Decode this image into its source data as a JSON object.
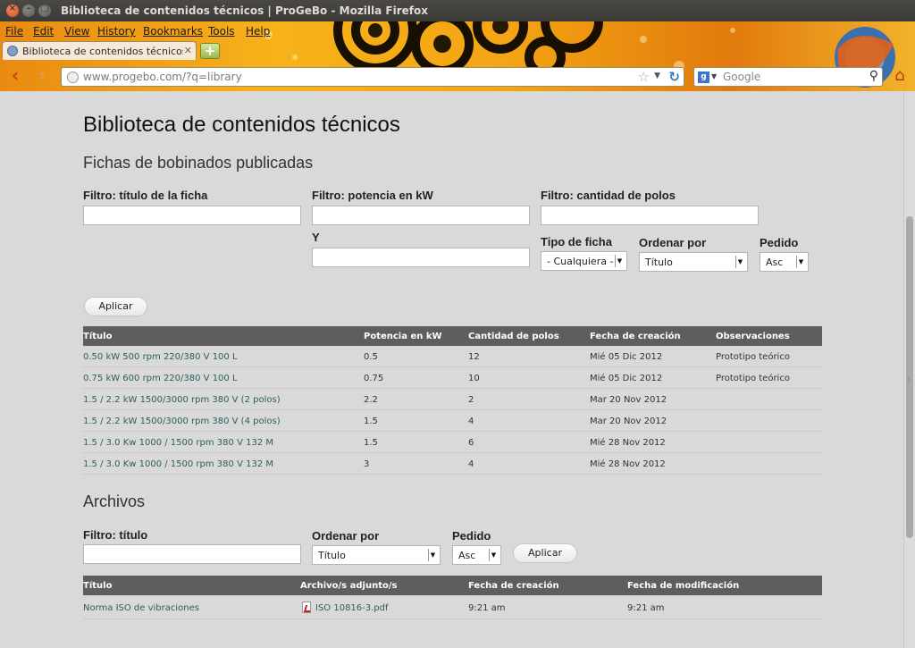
{
  "window": {
    "title": "Biblioteca de contenidos técnicos | ProGeBo - Mozilla Firefox"
  },
  "menu": {
    "file": "File",
    "edit": "Edit",
    "view": "View",
    "history": "History",
    "bookmarks": "Bookmarks",
    "tools": "Tools",
    "help": "Help"
  },
  "tab": {
    "label": "Biblioteca de contenidos técnicos | ..."
  },
  "navbar": {
    "url": "www.progebo.com/?q=library",
    "search_placeholder": "Google"
  },
  "page": {
    "title": "Biblioteca de contenidos técnicos",
    "fichas": {
      "heading": "Fichas de bobinados publicadas",
      "filter_title_label": "Filtro: título de la ficha",
      "filter_title_value": "",
      "filter_power_label": "Filtro: potencia en kW",
      "filter_power_value": "",
      "filter_y_label": "Y",
      "filter_y_value": "",
      "filter_poles_label": "Filtro: cantidad de polos",
      "filter_poles_value": "",
      "type_label": "Tipo de ficha",
      "type_value": "- Cualquiera -",
      "order_label": "Ordenar por",
      "order_value": "Título",
      "sort_label": "Pedido",
      "sort_value": "Asc",
      "apply_label": "Aplicar",
      "columns": [
        "Título",
        "Potencia en kW",
        "Cantidad de polos",
        "Fecha de creación",
        "Observaciones"
      ],
      "rows": [
        {
          "title": "0.50 kW 500 rpm 220/380 V 100 L",
          "power": "0.5",
          "poles": "12",
          "date": "Mié 05 Dic 2012",
          "notes": "Prototipo teórico"
        },
        {
          "title": "0.75 kW 600 rpm 220/380 V 100 L",
          "power": "0.75",
          "poles": "10",
          "date": "Mié 05 Dic 2012",
          "notes": "Prototipo teórico"
        },
        {
          "title": "1.5 / 2.2 kW 1500/3000 rpm 380 V (2 polos)",
          "power": "2.2",
          "poles": "2",
          "date": "Mar 20 Nov 2012",
          "notes": ""
        },
        {
          "title": "1.5 / 2.2 kW 1500/3000 rpm 380 V (4 polos)",
          "power": "1.5",
          "poles": "4",
          "date": "Mar 20 Nov 2012",
          "notes": ""
        },
        {
          "title": "1.5 / 3.0 Kw 1000 / 1500 rpm 380 V 132 M",
          "power": "1.5",
          "poles": "6",
          "date": "Mié 28 Nov 2012",
          "notes": ""
        },
        {
          "title": "1.5 / 3.0 Kw 1000 / 1500 rpm 380 V 132 M",
          "power": "3",
          "poles": "4",
          "date": "Mié 28 Nov 2012",
          "notes": ""
        }
      ]
    },
    "archivos": {
      "heading": "Archivos",
      "filter_title_label": "Filtro: título",
      "filter_title_value": "",
      "order_label": "Ordenar por",
      "order_value": "Título",
      "sort_label": "Pedido",
      "sort_value": "Asc",
      "apply_label": "Aplicar",
      "columns": [
        "Título",
        "Archivo/s adjunto/s",
        "Fecha de creación",
        "Fecha de modificación"
      ],
      "rows": [
        {
          "title": "Norma ISO de vibraciones",
          "file": "ISO 10816-3.pdf",
          "created": "9:21 am",
          "modified": "9:21 am"
        }
      ]
    }
  }
}
